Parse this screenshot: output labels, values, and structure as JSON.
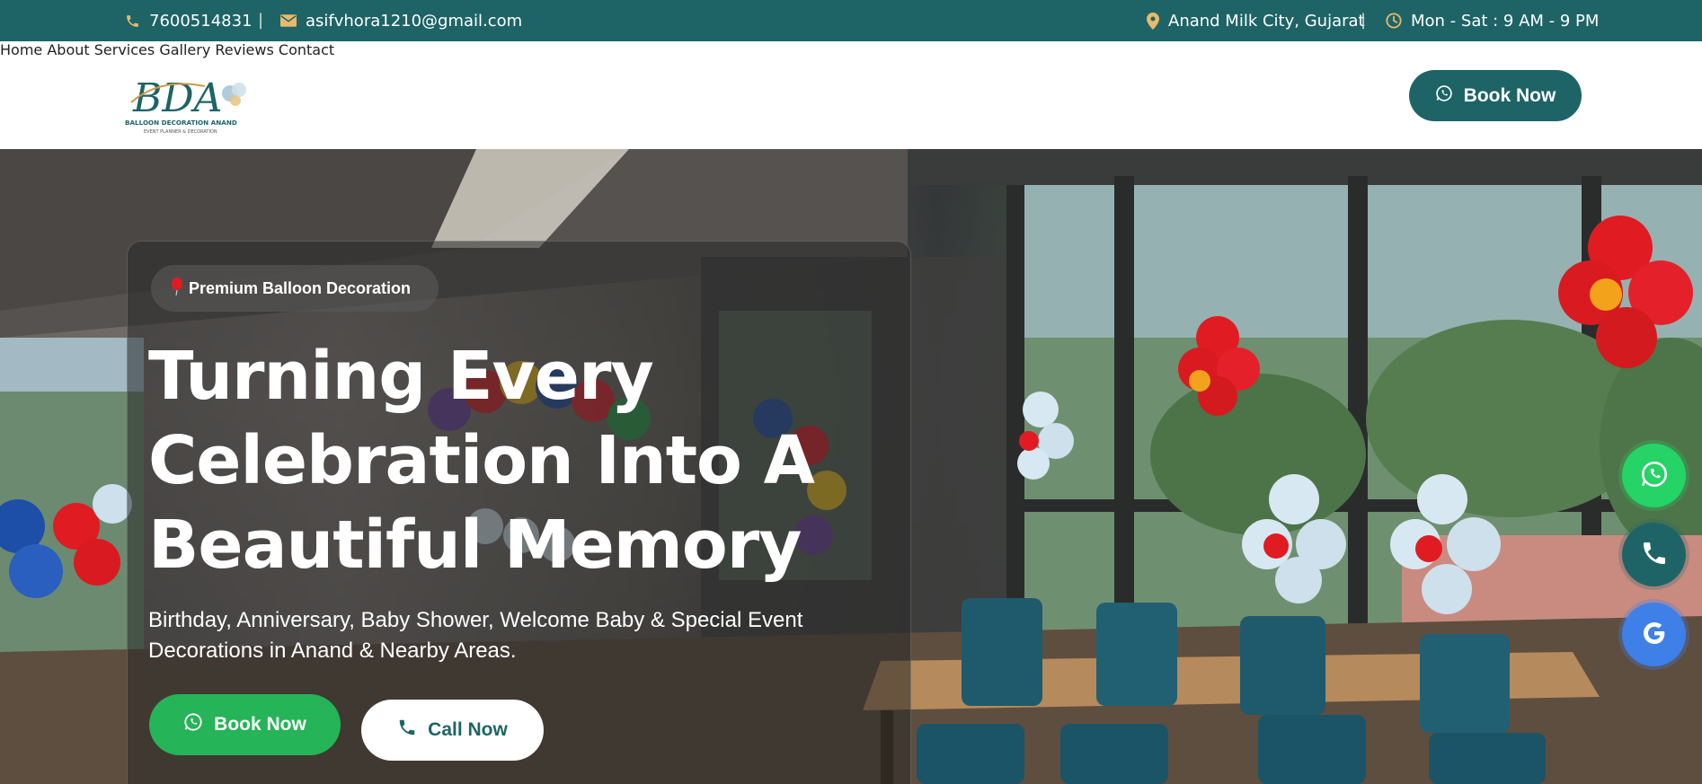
{
  "topbar": {
    "phone": "7600514831",
    "email": "asifvhora1210@gmail.com",
    "location": "Anand Milk City, Gujarat",
    "hours": "Mon - Sat : 9 AM - 9 PM",
    "separator": "|"
  },
  "header": {
    "logo": {
      "monogram": "BDA",
      "name": "BALLOON DECORATION ANAND",
      "tagline": "EVENT PLANNER & DECORATION"
    },
    "nav": [
      "Home",
      "About",
      "Services",
      "Gallery",
      "Reviews",
      "Contact"
    ],
    "book_label": "Book Now"
  },
  "hero": {
    "badge_icon": "balloon-icon",
    "badge": "Premium Balloon Decoration",
    "headline_line1": "Turning Every",
    "headline_line2": "Celebration Into A",
    "headline_line3": "Beautiful Memory",
    "subtitle": "Birthday, Anniversary, Baby Shower, Welcome Baby & Special Event Decorations in Anand & Nearby Areas.",
    "book_label": "Book Now",
    "call_label": "Call Now"
  },
  "floating": [
    "whatsapp-icon",
    "phone-icon",
    "google-icon"
  ],
  "colors": {
    "primary": "#1e6466",
    "accent": "#e9b96b",
    "whatsapp": "#25b457",
    "google": "#3f7fe8"
  }
}
